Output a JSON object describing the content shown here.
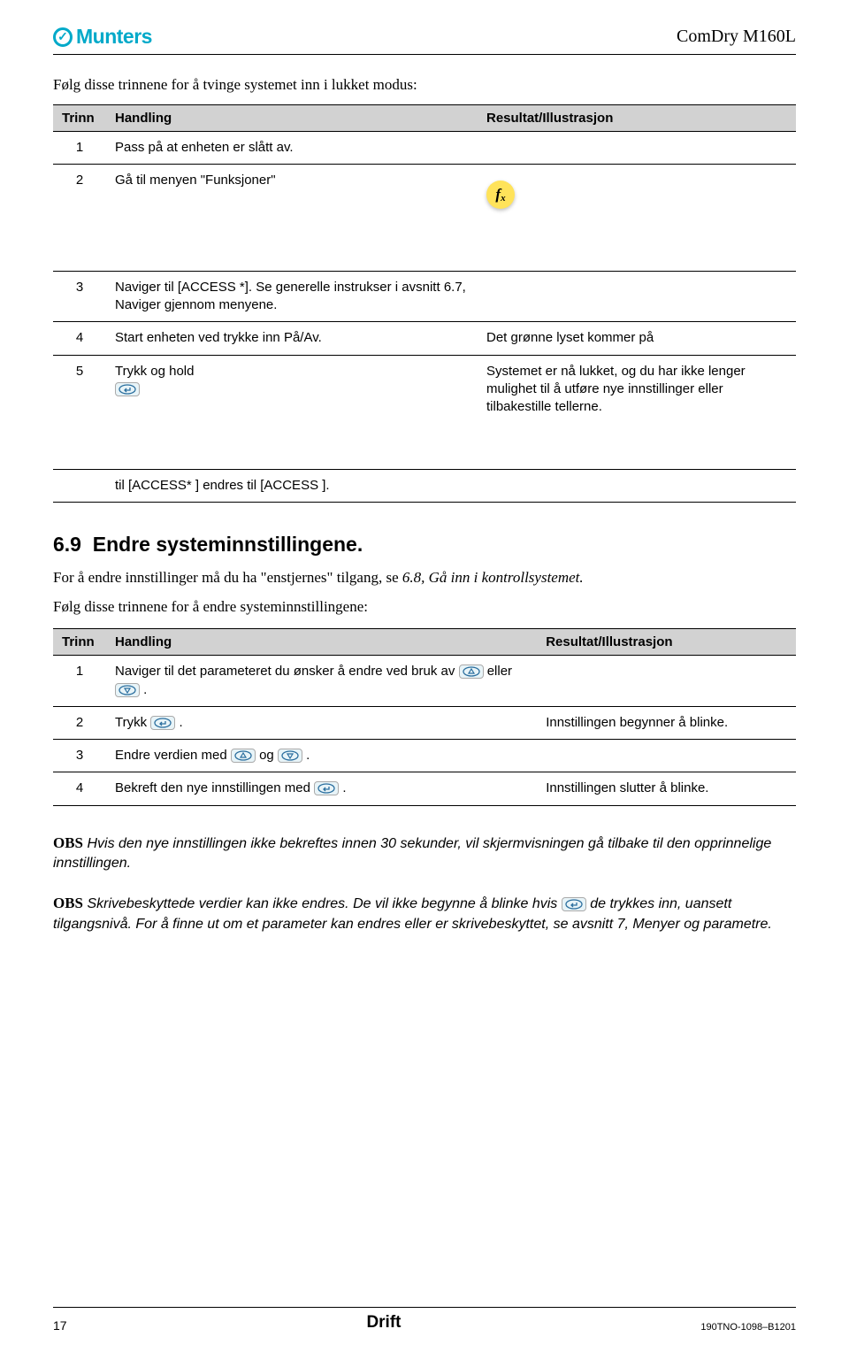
{
  "header": {
    "brand": "Munters",
    "doc_model": "ComDry M160L"
  },
  "intro1": "Følg disse trinnene for å tvinge systemet inn i lukket modus:",
  "table1": {
    "headers": {
      "step": "Trinn",
      "action": "Handling",
      "result": "Resultat/Illustrasjon"
    },
    "rows": [
      {
        "step": "1",
        "action": "Pass på at enheten er slått av.",
        "result": ""
      },
      {
        "step": "2",
        "action": "Gå til menyen \"Funksjoner\"",
        "result": ""
      },
      {
        "step": "3",
        "action": "Naviger til [ACCESS *]. Se generelle instrukser i avsnitt 6.7, Naviger gjennom menyene.",
        "result": ""
      },
      {
        "step": "4",
        "action": "Start enheten ved trykke inn På/Av.",
        "result": "Det grønne lyset kommer på"
      },
      {
        "step": "5",
        "action": "Trykk og hold",
        "result": "Systemet er nå lukket, og du har ikke lenger mulighet til å utføre nye innstillinger eller tilbakestille tellerne."
      },
      {
        "step": "",
        "action": "til [ACCESS* ] endres til [ACCESS ].",
        "result": ""
      }
    ]
  },
  "section": {
    "number": "6.9",
    "title": "Endre systeminnstillingene."
  },
  "para1_a": "For å endre innstillinger må du ha \"enstjernes\" tilgang, se ",
  "para1_b": "6.8, Gå inn i kontrollsystemet.",
  "para2": "Følg disse trinnene for å endre systeminnstillingene:",
  "table2": {
    "headers": {
      "step": "Trinn",
      "action": "Handling",
      "result": "Resultat/Illustrasjon"
    },
    "rows": [
      {
        "step": "1",
        "action_a": "Naviger til det parameteret du ønsker å endre ved bruk av ",
        "action_b": " eller ",
        "action_c": " .",
        "result": ""
      },
      {
        "step": "2",
        "action_a": "Trykk ",
        "action_b": " .",
        "result": "Innstillingen begynner å blinke."
      },
      {
        "step": "3",
        "action_a": "Endre verdien med ",
        "action_b": " og ",
        "action_c": " .",
        "result": ""
      },
      {
        "step": "4",
        "action_a": "Bekreft den nye innstillingen med ",
        "action_b": " .",
        "result": "Innstillingen slutter å blinke."
      }
    ]
  },
  "obs1": {
    "label": "OBS",
    "text": " Hvis den nye innstillingen ikke bekreftes innen 30 sekunder, vil skjermvisningen gå tilbake til den opprinnelige innstillingen."
  },
  "obs2": {
    "label": "OBS",
    "text_a": " Skrivebeskyttede verdier kan ikke endres. De vil ikke begynne å blinke hvis ",
    "text_b": " de trykkes inn, uansett tilgangsnivå. For å finne ut om et parameter kan endres eller er skrivebeskyttet, se avsnitt 7, Menyer og parametre."
  },
  "footer": {
    "page": "17",
    "title": "Drift",
    "docnum": "190TNO-1098–B1201"
  }
}
